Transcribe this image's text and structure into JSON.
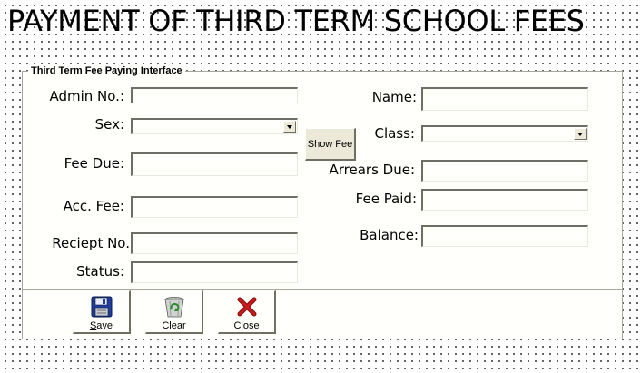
{
  "title": "PAYMENT OF THIRD TERM SCHOOL FEES",
  "group": {
    "legend": "Third Term Fee Paying Interface"
  },
  "left_fields": {
    "admin_no": {
      "label": "Admin No.:",
      "value": ""
    },
    "sex": {
      "label": "Sex:",
      "value": ""
    },
    "fee_due": {
      "label": "Fee Due:",
      "value": ""
    },
    "acc_fee": {
      "label": "Acc. Fee:",
      "value": ""
    },
    "reciept_no": {
      "label": "Reciept No.",
      "value": ""
    },
    "status": {
      "label": "Status:",
      "value": ""
    }
  },
  "right_fields": {
    "name": {
      "label": "Name:",
      "value": ""
    },
    "class": {
      "label": "Class:",
      "value": ""
    },
    "arrears_due": {
      "label": "Arrears Due:",
      "value": ""
    },
    "fee_paid": {
      "label": "Fee Paid:",
      "value": ""
    },
    "balance": {
      "label": "Balance:",
      "value": ""
    }
  },
  "show_fee_button": {
    "label": "Show Fee"
  },
  "toolbar": {
    "save": {
      "label_first": "S",
      "label_rest": "ave",
      "icon": "floppy-disk-icon"
    },
    "clear": {
      "label": "Clear",
      "icon": "recycle-bin-icon"
    },
    "close": {
      "label": "Close",
      "icon": "red-x-icon"
    }
  },
  "colors": {
    "form_background": "#fffffc",
    "button_face": "#ece9d8",
    "border_shadow": "#716f64",
    "close_icon_red": "#cc1a1a",
    "recycle_green": "#2c8a2c",
    "floppy_blue": "#1f3c9a"
  }
}
